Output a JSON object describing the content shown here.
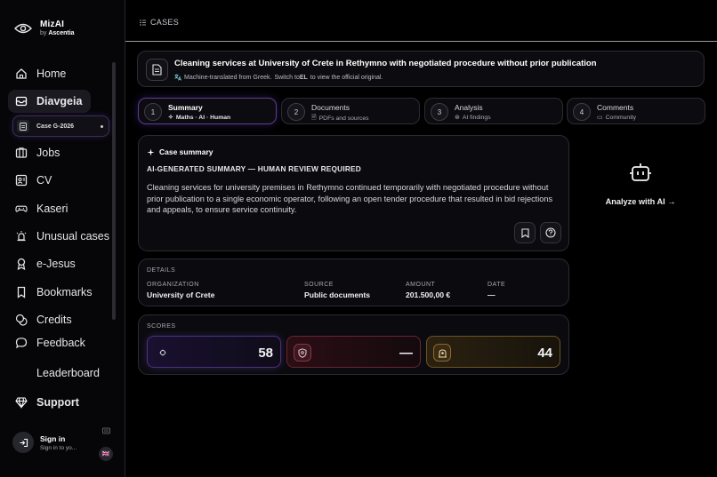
{
  "app": {
    "name": "MizAI",
    "by_prefix": "by",
    "by_brand": "Ascentia"
  },
  "sidebar": {
    "items": [
      {
        "label": "Home",
        "icon": "home-icon"
      },
      {
        "label": "Diavgeia",
        "icon": "inbox-icon"
      },
      {
        "label": "Jobs",
        "icon": "jobs-icon"
      },
      {
        "label": "CV",
        "icon": "id-card-icon"
      },
      {
        "label": "Kaseri",
        "icon": "gamepad-icon"
      },
      {
        "label": "Unusual cases",
        "icon": "siren-icon"
      },
      {
        "label": "e-Jesus",
        "icon": "badge-icon"
      },
      {
        "label": "Bookmarks",
        "icon": "bookmark-icon"
      },
      {
        "label": "Credits",
        "icon": "coins-icon"
      },
      {
        "label": "Feedback",
        "icon": "chat-icon"
      },
      {
        "label": "Leaderboard",
        "icon": "trophy-icon"
      },
      {
        "label": "Support",
        "icon": "gem-icon"
      }
    ],
    "active": "Diavgeia",
    "case_chip": "Case G-2026",
    "signin": {
      "title": "Sign in",
      "subtitle": "Sign in to yo..."
    },
    "language_flag": "🇬🇧"
  },
  "breadcrumb": {
    "label": "CASES"
  },
  "case": {
    "title": "Cleaning services at University of Crete in Rethymno with negotiated procedure without prior publication",
    "translation_note": "Machine-translated from Greek.",
    "switch_prefix": "Switch to",
    "switch_lang": "EL",
    "switch_suffix": "to view the official original."
  },
  "steps": [
    {
      "num": "1",
      "title": "Summary",
      "subtitle": "Maths · AI · Human",
      "active": true
    },
    {
      "num": "2",
      "title": "Documents",
      "subtitle": "PDFs and sources",
      "active": false
    },
    {
      "num": "3",
      "title": "Analysis",
      "subtitle": "AI findings",
      "active": false
    },
    {
      "num": "4",
      "title": "Comments",
      "subtitle": "Community",
      "active": false
    }
  ],
  "summary": {
    "header": "Case summary",
    "notice": "AI-GENERATED SUMMARY — HUMAN REVIEW REQUIRED",
    "body": "Cleaning services for university premises in Rethymno continued temporarily with negotiated procedure without prior publication to a single economic operator, following an open tender procedure that resulted in bid rejections and appeals, to ensure service continuity."
  },
  "analyze": {
    "label": "Analyze with AI",
    "arrow": "→"
  },
  "details": {
    "section": "DETAILS",
    "organization": {
      "label": "ORGANIZATION",
      "value": "University of Crete"
    },
    "source": {
      "label": "SOURCE",
      "value": "Public documents"
    },
    "amount": {
      "label": "AMOUNT",
      "value": "201.500,00 €"
    },
    "date": {
      "label": "DATE",
      "value": "—"
    }
  },
  "scores": {
    "section": "SCORES",
    "items": [
      {
        "value": "58",
        "icon": "math-icon",
        "color": "#8a5cf5"
      },
      {
        "value": "—",
        "icon": "shield-icon",
        "color": "#e0445a"
      },
      {
        "value": "44",
        "icon": "human-review-icon",
        "color": "#e3a63a"
      }
    ]
  }
}
